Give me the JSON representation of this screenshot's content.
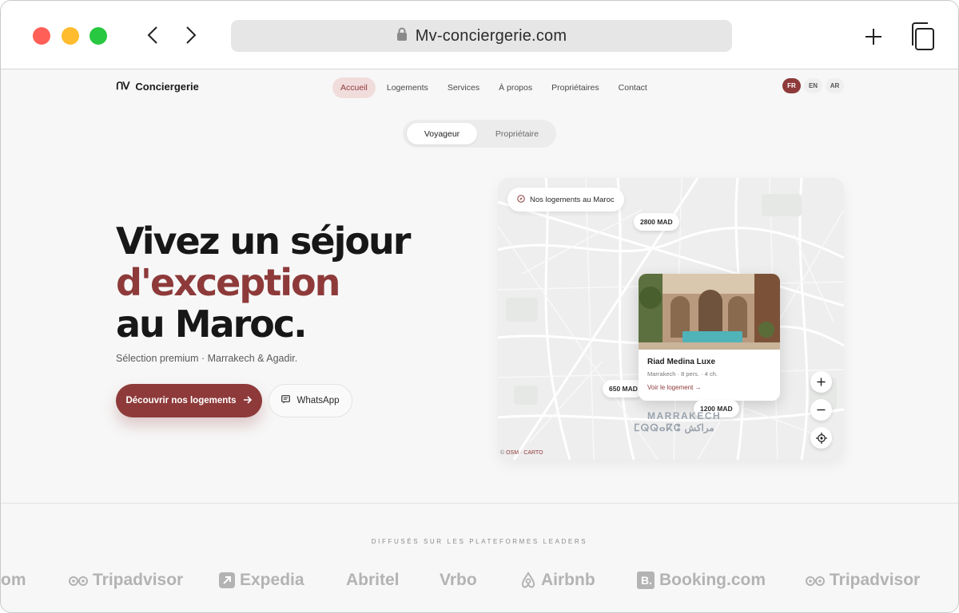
{
  "browser": {
    "url": "Mv-conciergerie.com"
  },
  "header": {
    "brand_mark": "ᑎᐯ",
    "brand_name": "Conciergerie",
    "nav": [
      "Accueil",
      "Logements",
      "Services",
      "À propos",
      "Propriétaires",
      "Contact"
    ],
    "active_nav": "Accueil",
    "languages": [
      "FR",
      "EN",
      "AR"
    ],
    "active_language": "FR"
  },
  "toggle": {
    "options": [
      "Voyageur",
      "Propriétaire"
    ],
    "selected": "Voyageur"
  },
  "hero": {
    "line1": "Vivez un séjour",
    "line2": "d'exception",
    "line3": "au Maroc.",
    "subtitle": "Sélection premium · Marrakech & Agadir.",
    "cta_label": "Découvrir nos logements",
    "whatsapp_label": "WhatsApp"
  },
  "map": {
    "label": "Nos logements au Maroc",
    "prices": [
      "2800 MAD",
      "650 MAD",
      "1200 MAD"
    ],
    "card": {
      "title": "Riad Medina Luxe",
      "meta": "Marrakech · 8 pers. · 4 ch.",
      "link": "Voir le logement →"
    },
    "city_latin": "MARRAKECH",
    "city_other": "ⵎⵕⵕⴰⴽⵛ مراكش",
    "attribution_prefix": "© ",
    "attribution": "OSM · CARTO"
  },
  "platforms": {
    "heading": "DIFFUSÉS SUR LES PLATEFORMES LEADERS",
    "partial": "om",
    "logos": [
      "Tripadvisor",
      "Expedia",
      "Abritel",
      "Vrbo",
      "Airbnb",
      "Booking.com",
      "Tripadvisor"
    ]
  },
  "colors": {
    "accent": "#8e3a3a",
    "accent_light": "#f1dcdc",
    "logo_grey": "#b3b3b3"
  }
}
